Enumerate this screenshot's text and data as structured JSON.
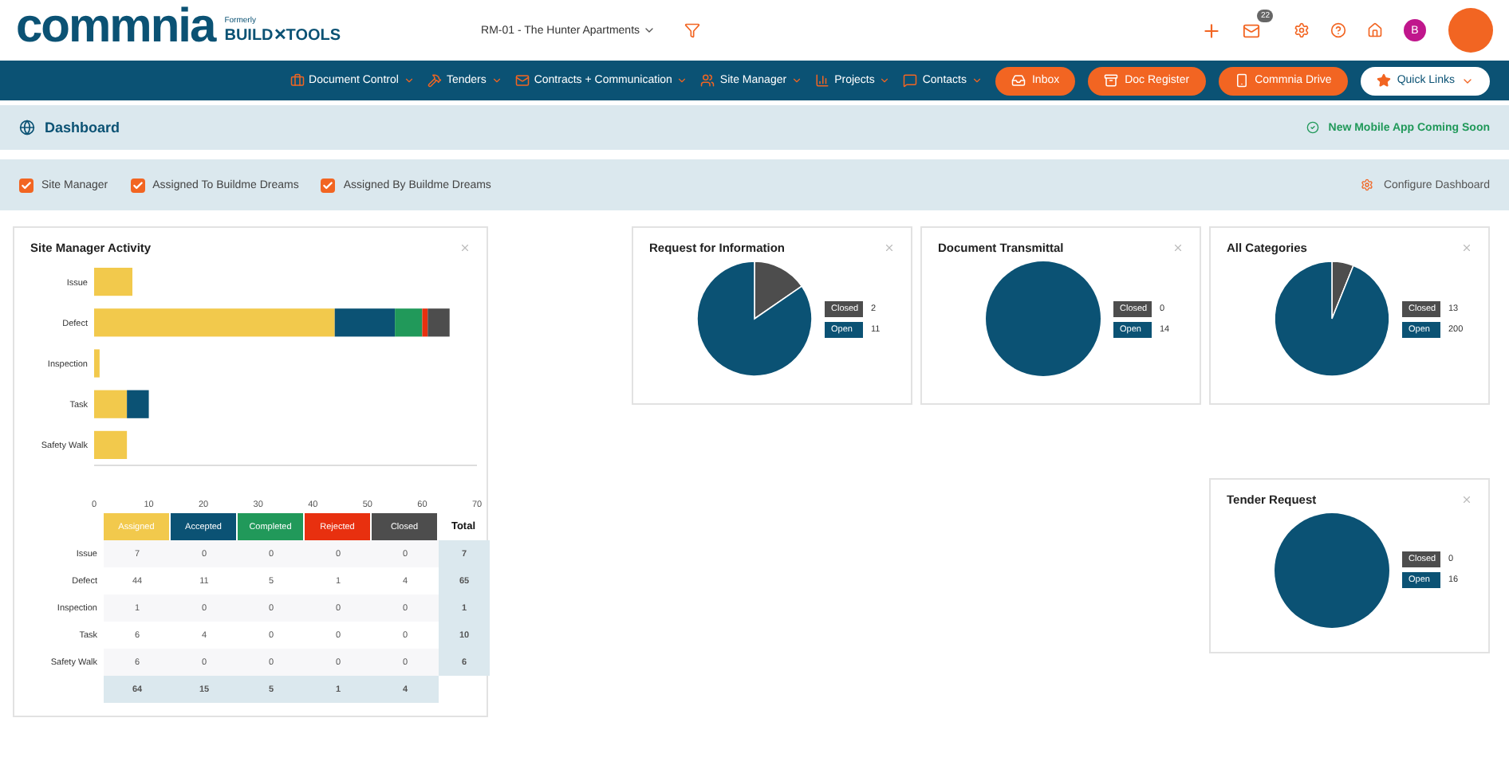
{
  "header": {
    "logo": "commnia",
    "formerly": "Formerly",
    "brand": "BUILD✕TOOLS",
    "project": "RM-01 - The Hunter Apartments",
    "mail_count": "22",
    "user_initial": "B"
  },
  "nav": {
    "menus": [
      {
        "label": "Document Control"
      },
      {
        "label": "Tenders"
      },
      {
        "label": "Contracts + Communication"
      },
      {
        "label": "Site Manager"
      },
      {
        "label": "Projects"
      },
      {
        "label": "Contacts"
      }
    ],
    "buttons": [
      {
        "label": "Inbox",
        "kind": "orange"
      },
      {
        "label": "Doc Register",
        "kind": "orange"
      },
      {
        "label": "Commnia Drive",
        "kind": "orange"
      },
      {
        "label": "Quick Links",
        "kind": "white"
      }
    ]
  },
  "page_title": "Dashboard",
  "notice": "New Mobile App Coming Soon",
  "filters": [
    {
      "label": "Site Manager",
      "checked": true
    },
    {
      "label": "Assigned To Buildme Dreams",
      "checked": true
    },
    {
      "label": "Assigned By Buildme Dreams",
      "checked": true
    }
  ],
  "configure": "Configure Dashboard",
  "activity": {
    "title": "Site Manager Activity",
    "chart_data": {
      "type": "bar",
      "orientation": "horizontal",
      "stacked": true,
      "categories": [
        "Issue",
        "Defect",
        "Inspection",
        "Task",
        "Safety Walk"
      ],
      "series": [
        {
          "name": "Assigned",
          "color": "#f2c94c",
          "values": [
            7,
            44,
            1,
            6,
            6
          ]
        },
        {
          "name": "Accepted",
          "color": "#0b5274",
          "values": [
            0,
            11,
            0,
            4,
            0
          ]
        },
        {
          "name": "Completed",
          "color": "#21995a",
          "values": [
            0,
            5,
            0,
            0,
            0
          ]
        },
        {
          "name": "Rejected",
          "color": "#e8300f",
          "values": [
            0,
            1,
            0,
            0,
            0
          ]
        },
        {
          "name": "Closed",
          "color": "#4d4d4d",
          "values": [
            0,
            4,
            0,
            0,
            0
          ]
        }
      ],
      "xlim": [
        0,
        70
      ],
      "xticks": [
        0,
        10,
        20,
        30,
        40,
        50,
        60,
        70
      ]
    },
    "table": {
      "total_label": "Total",
      "rows": [
        {
          "label": "Issue",
          "cells": [
            "7",
            "0",
            "0",
            "0",
            "0"
          ],
          "total": "7"
        },
        {
          "label": "Defect",
          "cells": [
            "44",
            "11",
            "5",
            "1",
            "4"
          ],
          "total": "65"
        },
        {
          "label": "Inspection",
          "cells": [
            "1",
            "0",
            "0",
            "0",
            "0"
          ],
          "total": "1"
        },
        {
          "label": "Task",
          "cells": [
            "6",
            "4",
            "0",
            "0",
            "0"
          ],
          "total": "10"
        },
        {
          "label": "Safety Walk",
          "cells": [
            "6",
            "0",
            "0",
            "0",
            "0"
          ],
          "total": "6"
        }
      ],
      "totals": [
        "64",
        "15",
        "5",
        "1",
        "4"
      ]
    }
  },
  "pies": [
    {
      "title": "Request for Information",
      "legend_values": [
        "2",
        "11"
      ],
      "chart_data": {
        "type": "pie",
        "categories": [
          "Closed",
          "Open"
        ],
        "values": [
          15.4,
          84.6
        ]
      }
    },
    {
      "title": "Document Transmittal",
      "legend_values": [
        "0",
        "14"
      ],
      "chart_data": {
        "type": "pie",
        "categories": [
          "Closed",
          "Open"
        ],
        "values": [
          0,
          100
        ]
      }
    },
    {
      "title": "All Categories",
      "legend_values": [
        "13",
        "200"
      ],
      "chart_data": {
        "type": "pie",
        "categories": [
          "Closed",
          "Open"
        ],
        "values": [
          6.1,
          93.9
        ]
      }
    },
    {
      "title": "Tender Request",
      "legend_values": [
        "0",
        "16"
      ],
      "chart_data": {
        "type": "pie",
        "categories": [
          "Closed",
          "Open"
        ],
        "values": [
          0,
          100
        ]
      }
    }
  ]
}
